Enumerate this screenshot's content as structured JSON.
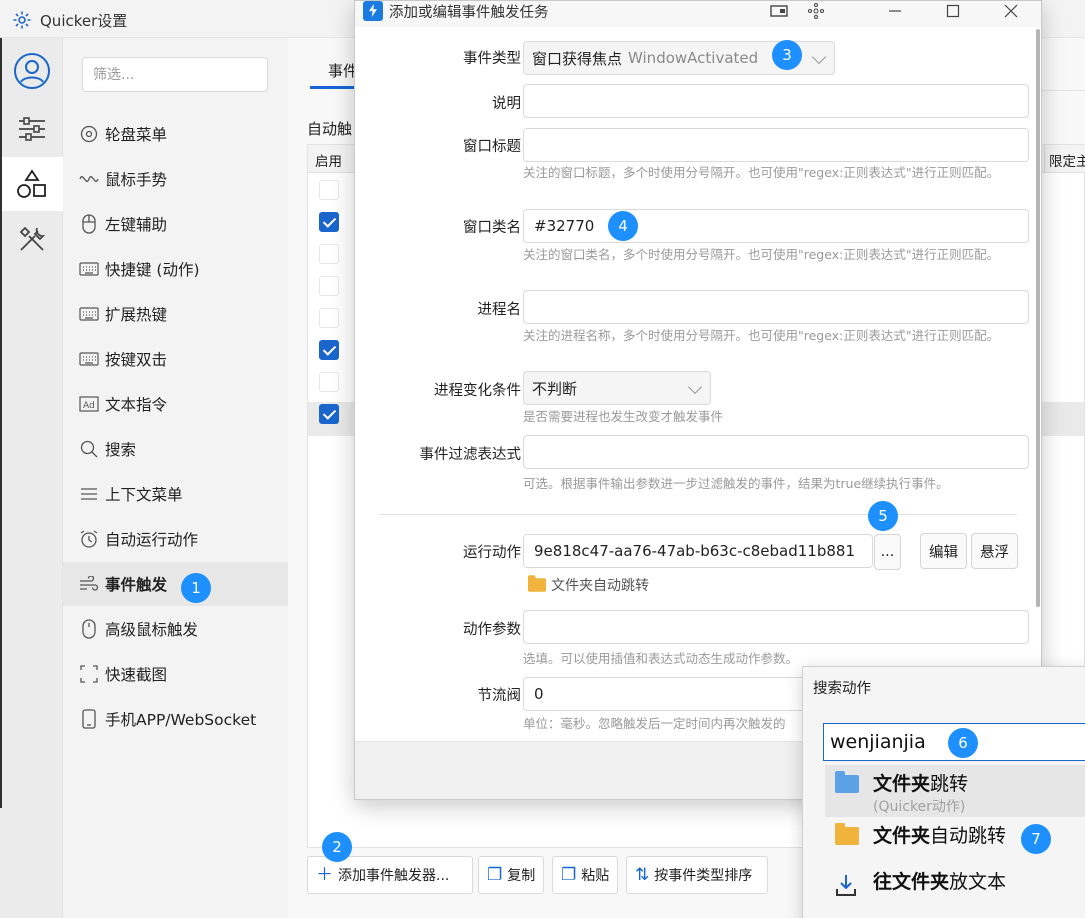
{
  "main_window": {
    "title": "Quicker设置",
    "filter_placeholder": "筛选...",
    "nav_items": [
      {
        "label": "轮盘菜单",
        "icon": "radial-menu-icon"
      },
      {
        "label": "鼠标手势",
        "icon": "mouse-gesture-icon"
      },
      {
        "label": "左键辅助",
        "icon": "mouse-left-icon"
      },
      {
        "label": "快捷键 (动作)",
        "icon": "keyboard-icon"
      },
      {
        "label": "扩展热键",
        "icon": "keyboard-icon"
      },
      {
        "label": "按键双击",
        "icon": "keyboard-icon"
      },
      {
        "label": "文本指令",
        "icon": "ad-text-icon"
      },
      {
        "label": "搜索",
        "icon": "search-icon"
      },
      {
        "label": "上下文菜单",
        "icon": "menu-lines-icon"
      },
      {
        "label": "自动运行动作",
        "icon": "alarm-clock-icon"
      },
      {
        "label": "事件触发",
        "icon": "wind-icon",
        "active": true
      },
      {
        "label": "高级鼠标触发",
        "icon": "mouse-icon"
      },
      {
        "label": "快速截图",
        "icon": "screenshot-frame-icon"
      },
      {
        "label": "手机APP/WebSocket",
        "icon": "phone-icon"
      }
    ],
    "tab_label": "事件",
    "section_label": "自动触",
    "table": {
      "col_enabled": "启用",
      "col_limit": "限定主",
      "checkboxes": [
        false,
        true,
        false,
        false,
        false,
        true,
        false,
        true
      ]
    },
    "toolbar": {
      "add_label": "添加事件触发器...",
      "copy_label": "复制",
      "paste_label": "粘贴",
      "sort_label": "按事件类型排序"
    }
  },
  "dialog": {
    "title": "添加或编辑事件触发任务",
    "event_type_label": "事件类型",
    "event_type_value": "窗口获得焦点",
    "event_type_en": "WindowActivated",
    "desc_label": "说明",
    "desc_value": "",
    "window_title_label": "窗口标题",
    "window_title_value": "",
    "window_title_hint": "关注的窗口标题，多个时使用分号隔开。也可使用\"regex:正则表达式\"进行正则匹配。",
    "window_class_label": "窗口类名",
    "window_class_value": "#32770",
    "window_class_hint": "关注的窗口类名，多个时使用分号隔开。也可使用\"regex:正则表达式\"进行正则匹配。",
    "process_label": "进程名",
    "process_value": "",
    "process_hint": "关注的进程名称，多个时使用分号隔开。也可使用\"regex:正则表达式\"进行正则匹配。",
    "process_change_label": "进程变化条件",
    "process_change_value": "不判断",
    "process_change_hint": "是否需要进程也发生改变才触发事件",
    "filter_expr_label": "事件过滤表达式",
    "filter_expr_value": "",
    "filter_expr_hint": "可选。根据事件输出参数进一步过滤触发的事件，结果为true继续执行事件。",
    "run_action_label": "运行动作",
    "run_action_value": "9e818c47-aa76-47ab-b63c-c8ebad11b881",
    "browse_label": "...",
    "edit_label": "编辑",
    "float_label": "悬浮",
    "action_name": "文件夹自动跳转",
    "action_params_label": "动作参数",
    "action_params_value": "",
    "action_params_hint": "选填。可以使用插值和表达式动态生成动作参数。",
    "throttle_label": "节流阀",
    "throttle_value": "0",
    "throttle_hint": "单位：毫秒。忽略触发后一定时间内再次触发的"
  },
  "search_popup": {
    "title": "搜索动作",
    "query": "wenjianjia",
    "results": [
      {
        "bold": "文件夹",
        "rest": "跳转",
        "sub": "(Quicker动作)",
        "icon": "folder-icon",
        "selected": true
      },
      {
        "bold": "文件夹",
        "rest": "自动跳转",
        "sub": "",
        "icon": "folder-arrow-icon",
        "selected": false
      },
      {
        "bold": "往文件夹",
        "rest": "放文本",
        "sub": "",
        "icon": "download-to-icon",
        "selected": false
      }
    ]
  },
  "badges": [
    "1",
    "2",
    "3",
    "4",
    "5",
    "6",
    "7"
  ],
  "colors": {
    "accent": "#1a66cc",
    "badge": "#1e8fff",
    "folder": "#5aa1e6",
    "folder_orange": "#f0b33c"
  }
}
